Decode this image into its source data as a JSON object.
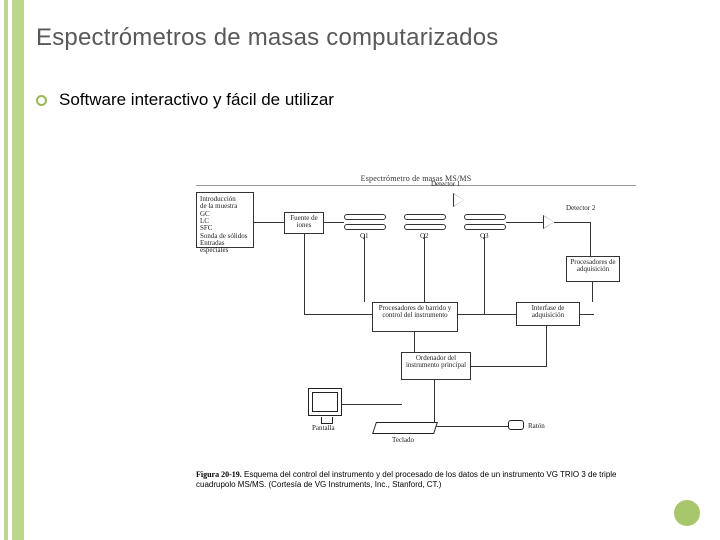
{
  "slide": {
    "title": "Espectrómetros de masas computarizados",
    "bullet1": "Software interactivo y fácil de utilizar"
  },
  "figure": {
    "header": "Espectrómetro de masas MS/MS",
    "intro": {
      "l1": "Introducción",
      "l2": "de la muestra",
      "l3": "GC",
      "l4": "LC",
      "l5": "SFC",
      "l6": "Sonda de sólidos",
      "l7": "Entradas especiales"
    },
    "fuente": "Fuente de iones",
    "q1": "Q1",
    "q2": "Q2",
    "q3": "Q3",
    "det1": "Detector 1",
    "det2": "Detector 2",
    "proc": "Procesadores de adquisición",
    "barrido": "Procesadores de barrido y control del instrumento",
    "interfase": "Interfase de adquisición",
    "ordenador": "Ordenador del instrumento principal",
    "pantalla": "Pantalla",
    "teclado": "Teclado",
    "raton": "Ratón",
    "caption_lead": "Figura 20-19.",
    "caption_body": " Esquema del control del instrumento y del procesado de los datos de un instrumento VG TRIO 3 de triple cuadrupolo MS/MS. (Cortesía de VG Instruments, Inc., Stanford, CT.)"
  }
}
